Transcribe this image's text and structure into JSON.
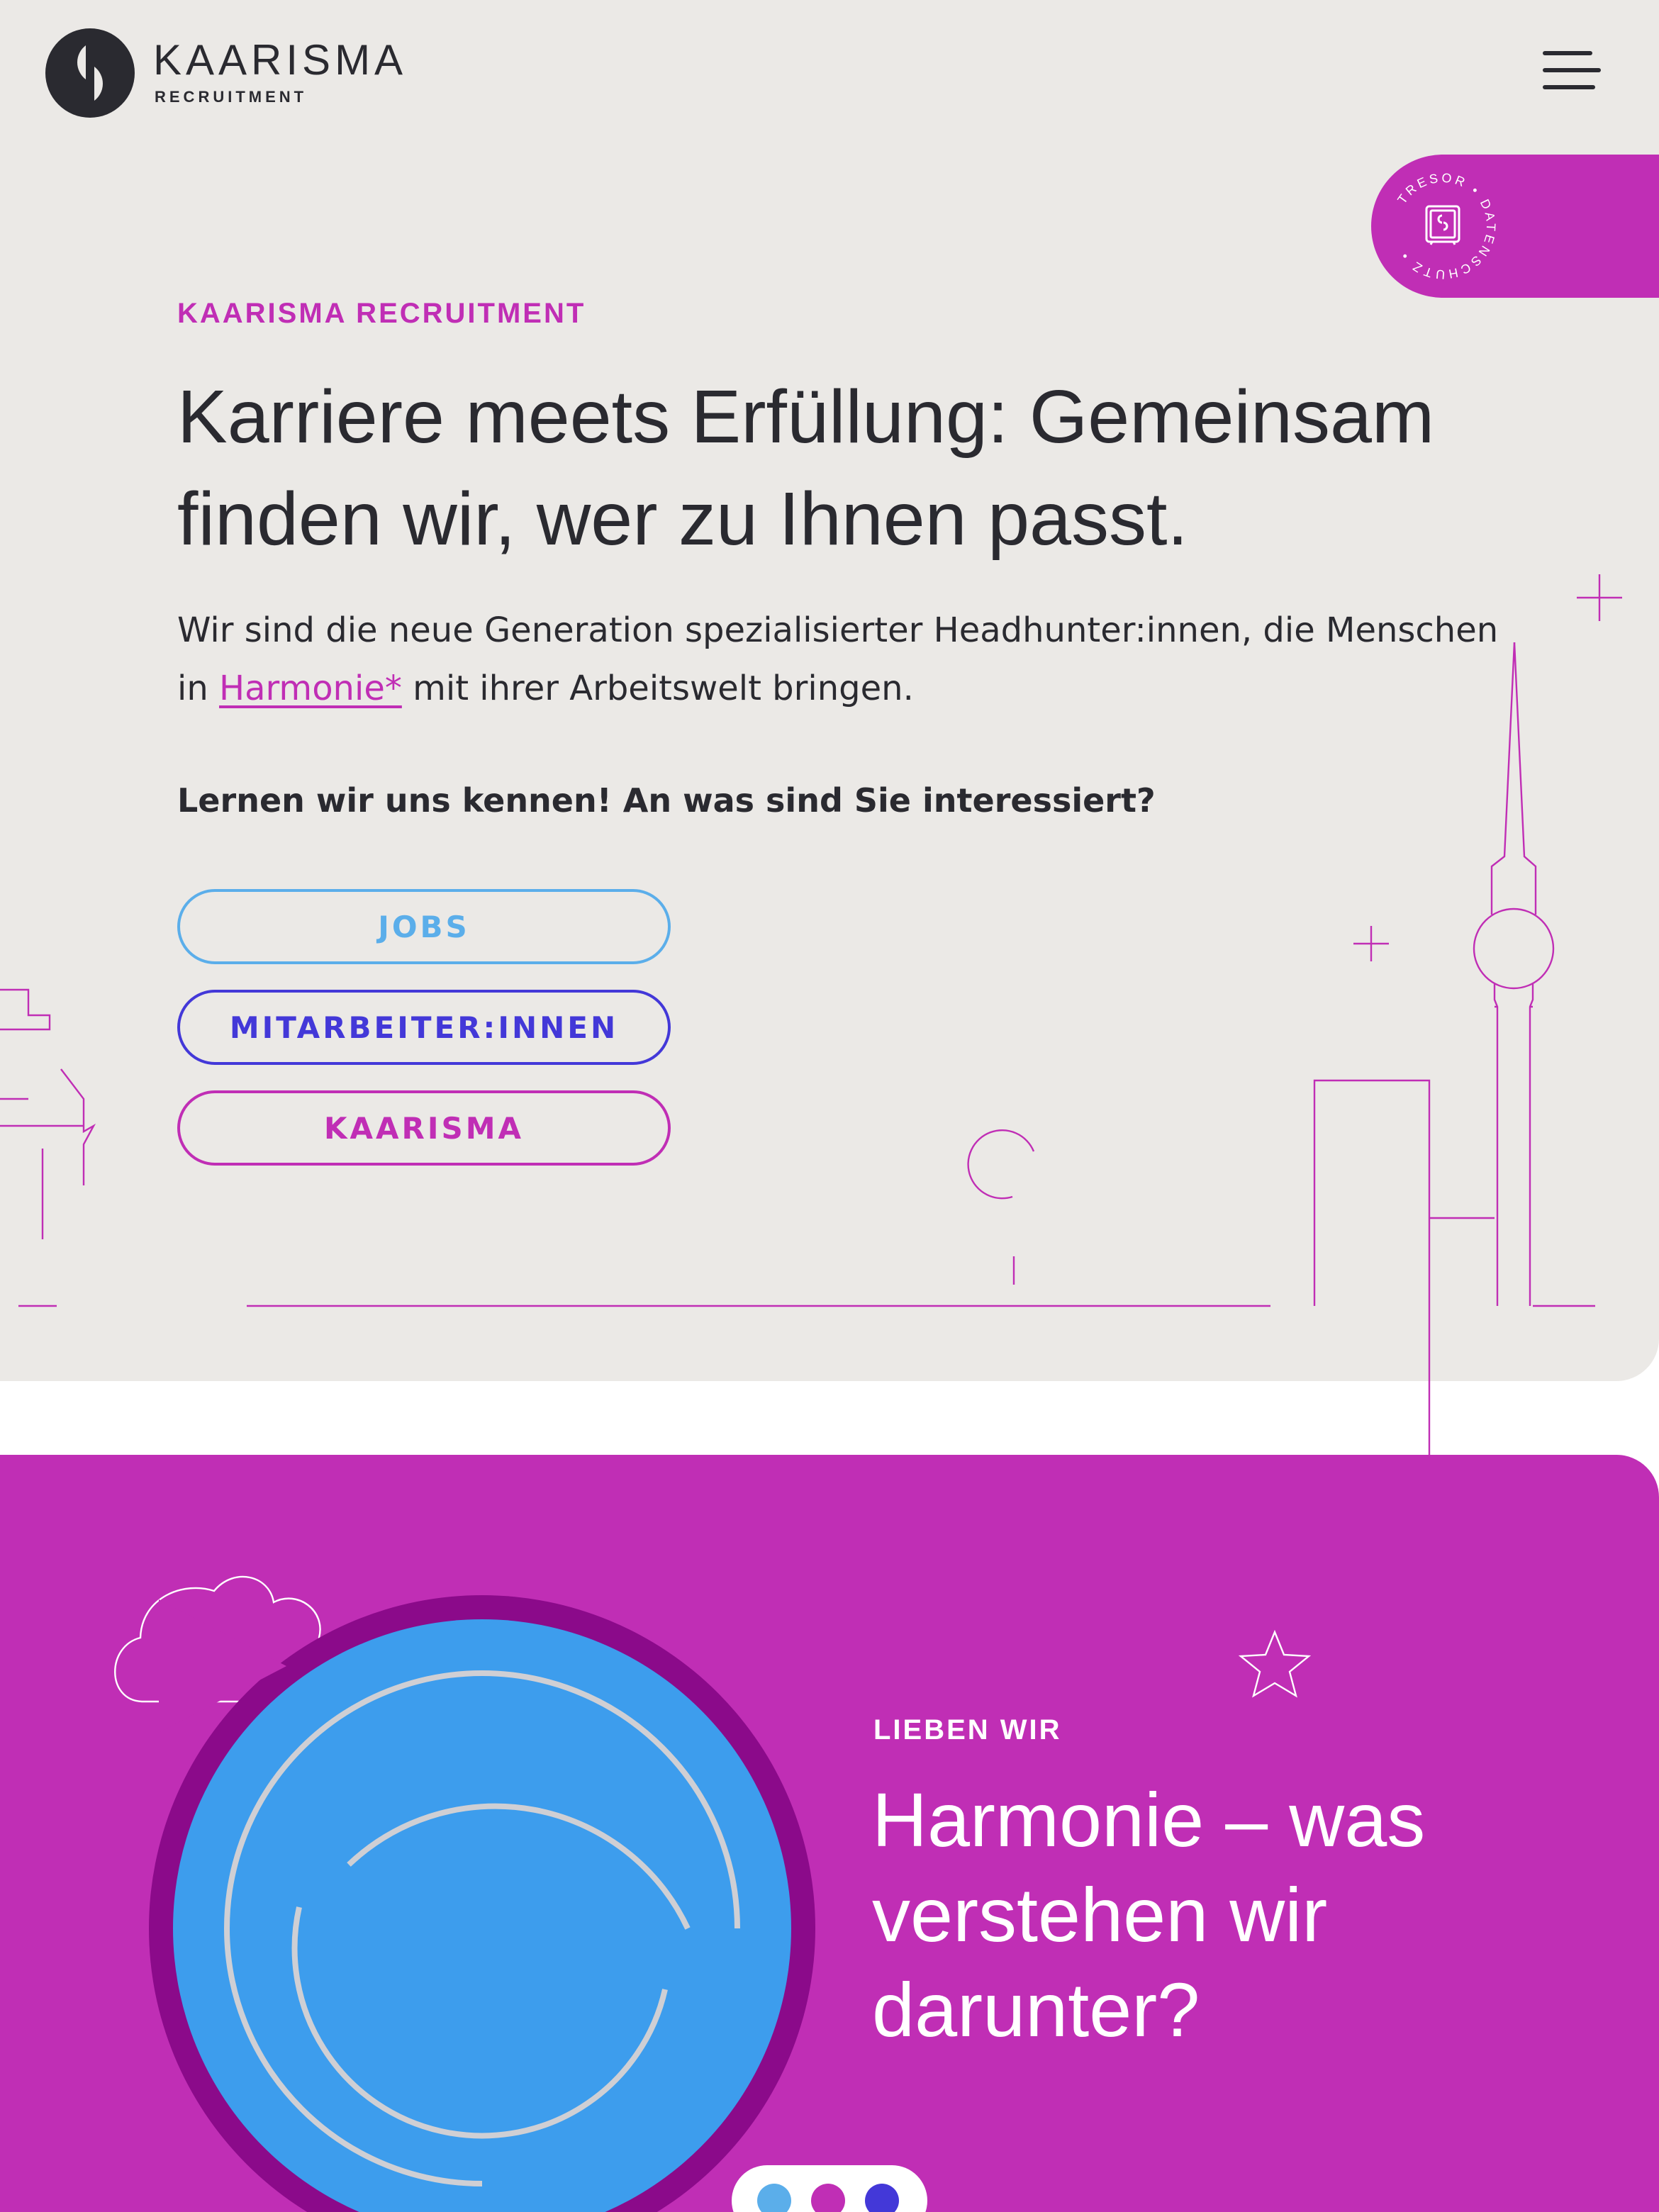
{
  "header": {
    "brand_name": "KAARISMA",
    "brand_sub": "RECRUITMENT",
    "menu_icon": "hamburger-menu-icon"
  },
  "tresor_badge": {
    "ring_text": "TRESOR • DATENSCHUTZ •",
    "icon": "safe-icon",
    "color": "#c02eb5"
  },
  "hero": {
    "eyebrow": "KAARISMA RECRUITMENT",
    "headline_line1": "Karriere meets Erfüllung: Gemeinsam",
    "headline_line2": "finden wir, wer zu Ihnen passt.",
    "intro_line1": "Wir sind die neue Generation spezialisierter Headhunter:innen, die Menschen",
    "intro_prefix": "in",
    "intro_link": "Harmonie*",
    "intro_suffix": "mit ihrer Arbeitswelt bringen.",
    "question": "Lernen wir uns kennen! An was sind Sie interessiert?",
    "buttons": [
      {
        "label": "JOBS",
        "color": "#5baeea"
      },
      {
        "label": "MITARBEITER:INNEN",
        "color": "#4338d8"
      },
      {
        "label": "KAARISMA",
        "color": "#c02eb5"
      }
    ],
    "background": "#ebe9e6"
  },
  "section2": {
    "eyebrow": "LIEBEN WIR",
    "title_line1": "Harmonie – was",
    "title_line2": "verstehen wir",
    "title_line3": "darunter?",
    "background": "#c02eb5",
    "video": {
      "icon": "play-icon",
      "fill": "#3d9ded",
      "ring": "#8b0a8a"
    },
    "dots": [
      {
        "color": "#5baeea"
      },
      {
        "color": "#c02eb5"
      },
      {
        "color": "#4338d8"
      }
    ]
  }
}
